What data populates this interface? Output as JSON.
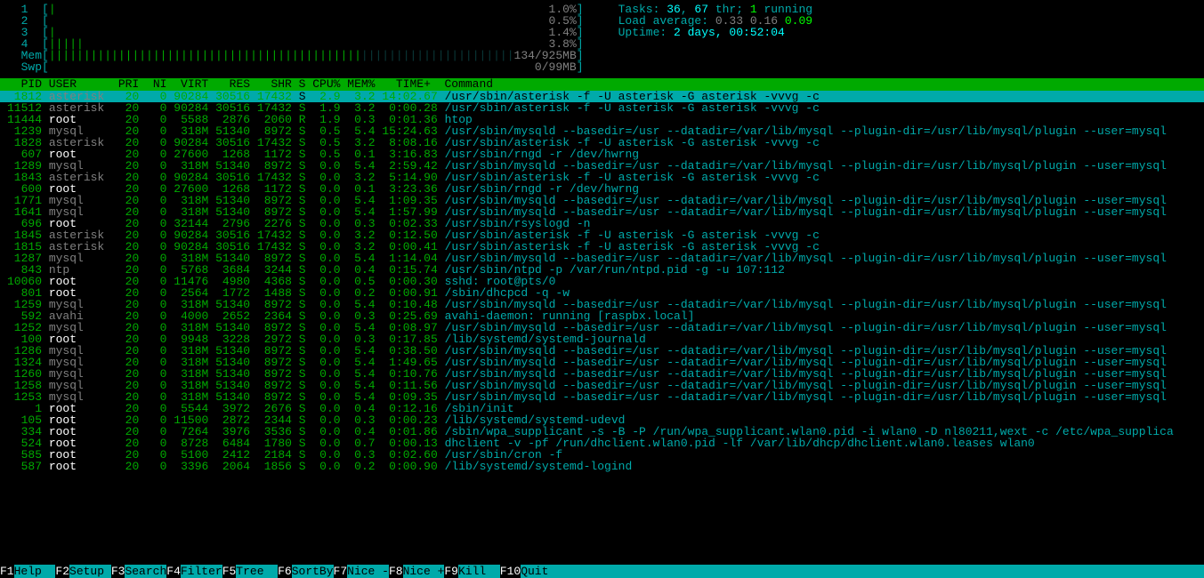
{
  "cpus": [
    {
      "id": "1",
      "bar": "|",
      "pct": "1.0%"
    },
    {
      "id": "2",
      "bar": "",
      "pct": "0.5%"
    },
    {
      "id": "3",
      "bar": "|",
      "pct": "1.4%"
    },
    {
      "id": "4",
      "bar": "|||||",
      "pct": "3.8%"
    }
  ],
  "mem": {
    "label": "Mem",
    "bar": "|||||||||||||||||||||||||||||||||||||||||||||",
    "val": "134/925MB"
  },
  "swp": {
    "label": "Swp",
    "bar": "",
    "val": "0/99MB"
  },
  "tasks": {
    "prefix": "Tasks: ",
    "procs": "36",
    "mid": ", ",
    "threads": "67",
    "thr_label": " thr; ",
    "running": "1",
    "running_label": " running"
  },
  "load": {
    "prefix": "Load average: ",
    "l1": "0.33",
    "l2": "0.16",
    "l3": "0.09"
  },
  "uptime": {
    "prefix": "Uptime: ",
    "val": "2 days, 00:52:04"
  },
  "columns": "  PID USER      PRI  NI  VIRT   RES   SHR S CPU% MEM%   TIME+  Command",
  "processes": [
    {
      "pid": " 1812",
      "user": "asterisk",
      "pri": " 20",
      "ni": "  0",
      "virt": "90284",
      "res": "30516",
      "shr": "17432",
      "s": "S",
      "cpu": " 2.9",
      "mem": " 3.2",
      "time": "14:02.67",
      "cmd": "/usr/sbin/asterisk -f -U asterisk -G asterisk -vvvg -c",
      "selected": true
    },
    {
      "pid": "11512",
      "user": "asterisk",
      "pri": " 20",
      "ni": "  0",
      "virt": "90284",
      "res": "30516",
      "shr": "17432",
      "s": "S",
      "cpu": " 1.9",
      "mem": " 3.2",
      "time": " 0:00.28",
      "cmd": "/usr/sbin/asterisk -f -U asterisk -G asterisk -vvvg -c"
    },
    {
      "pid": "11444",
      "user": "root",
      "pri": " 20",
      "ni": "  0",
      "virt": " 5588",
      "res": " 2876",
      "shr": " 2060",
      "s": "R",
      "cpu": " 1.9",
      "mem": " 0.3",
      "time": " 0:01.36",
      "cmd": "htop"
    },
    {
      "pid": " 1239",
      "user": "mysql",
      "pri": " 20",
      "ni": "  0",
      "virt": " 318M",
      "res": "51340",
      "shr": " 8972",
      "s": "S",
      "cpu": " 0.5",
      "mem": " 5.4",
      "time": "15:24.63",
      "cmd": "/usr/sbin/mysqld --basedir=/usr --datadir=/var/lib/mysql --plugin-dir=/usr/lib/mysql/plugin --user=mysql"
    },
    {
      "pid": " 1828",
      "user": "asterisk",
      "pri": " 20",
      "ni": "  0",
      "virt": "90284",
      "res": "30516",
      "shr": "17432",
      "s": "S",
      "cpu": " 0.5",
      "mem": " 3.2",
      "time": " 8:08.16",
      "cmd": "/usr/sbin/asterisk -f -U asterisk -G asterisk -vvvg -c"
    },
    {
      "pid": "  607",
      "user": "root",
      "pri": " 20",
      "ni": "  0",
      "virt": "27600",
      "res": " 1268",
      "shr": " 1172",
      "s": "S",
      "cpu": " 0.5",
      "mem": " 0.1",
      "time": " 3:16.83",
      "cmd": "/usr/sbin/rngd -r /dev/hwrng"
    },
    {
      "pid": " 1289",
      "user": "mysql",
      "pri": " 20",
      "ni": "  0",
      "virt": " 318M",
      "res": "51340",
      "shr": " 8972",
      "s": "S",
      "cpu": " 0.0",
      "mem": " 5.4",
      "time": " 2:59.42",
      "cmd": "/usr/sbin/mysqld --basedir=/usr --datadir=/var/lib/mysql --plugin-dir=/usr/lib/mysql/plugin --user=mysql"
    },
    {
      "pid": " 1843",
      "user": "asterisk",
      "pri": " 20",
      "ni": "  0",
      "virt": "90284",
      "res": "30516",
      "shr": "17432",
      "s": "S",
      "cpu": " 0.0",
      "mem": " 3.2",
      "time": " 5:14.90",
      "cmd": "/usr/sbin/asterisk -f -U asterisk -G asterisk -vvvg -c"
    },
    {
      "pid": "  600",
      "user": "root",
      "pri": " 20",
      "ni": "  0",
      "virt": "27600",
      "res": " 1268",
      "shr": " 1172",
      "s": "S",
      "cpu": " 0.0",
      "mem": " 0.1",
      "time": " 3:23.36",
      "cmd": "/usr/sbin/rngd -r /dev/hwrng"
    },
    {
      "pid": " 1771",
      "user": "mysql",
      "pri": " 20",
      "ni": "  0",
      "virt": " 318M",
      "res": "51340",
      "shr": " 8972",
      "s": "S",
      "cpu": " 0.0",
      "mem": " 5.4",
      "time": " 1:09.35",
      "cmd": "/usr/sbin/mysqld --basedir=/usr --datadir=/var/lib/mysql --plugin-dir=/usr/lib/mysql/plugin --user=mysql"
    },
    {
      "pid": " 1641",
      "user": "mysql",
      "pri": " 20",
      "ni": "  0",
      "virt": " 318M",
      "res": "51340",
      "shr": " 8972",
      "s": "S",
      "cpu": " 0.0",
      "mem": " 5.4",
      "time": " 1:57.99",
      "cmd": "/usr/sbin/mysqld --basedir=/usr --datadir=/var/lib/mysql --plugin-dir=/usr/lib/mysql/plugin --user=mysql"
    },
    {
      "pid": "  696",
      "user": "root",
      "pri": " 20",
      "ni": "  0",
      "virt": "32144",
      "res": " 2796",
      "shr": " 2276",
      "s": "S",
      "cpu": " 0.0",
      "mem": " 0.3",
      "time": " 0:02.33",
      "cmd": "/usr/sbin/rsyslogd -n"
    },
    {
      "pid": " 1845",
      "user": "asterisk",
      "pri": " 20",
      "ni": "  0",
      "virt": "90284",
      "res": "30516",
      "shr": "17432",
      "s": "S",
      "cpu": " 0.0",
      "mem": " 3.2",
      "time": " 0:12.50",
      "cmd": "/usr/sbin/asterisk -f -U asterisk -G asterisk -vvvg -c"
    },
    {
      "pid": " 1815",
      "user": "asterisk",
      "pri": " 20",
      "ni": "  0",
      "virt": "90284",
      "res": "30516",
      "shr": "17432",
      "s": "S",
      "cpu": " 0.0",
      "mem": " 3.2",
      "time": " 0:00.41",
      "cmd": "/usr/sbin/asterisk -f -U asterisk -G asterisk -vvvg -c"
    },
    {
      "pid": " 1287",
      "user": "mysql",
      "pri": " 20",
      "ni": "  0",
      "virt": " 318M",
      "res": "51340",
      "shr": " 8972",
      "s": "S",
      "cpu": " 0.0",
      "mem": " 5.4",
      "time": " 1:14.04",
      "cmd": "/usr/sbin/mysqld --basedir=/usr --datadir=/var/lib/mysql --plugin-dir=/usr/lib/mysql/plugin --user=mysql"
    },
    {
      "pid": "  843",
      "user": "ntp",
      "pri": " 20",
      "ni": "  0",
      "virt": " 5768",
      "res": " 3684",
      "shr": " 3244",
      "s": "S",
      "cpu": " 0.0",
      "mem": " 0.4",
      "time": " 0:15.74",
      "cmd": "/usr/sbin/ntpd -p /var/run/ntpd.pid -g -u 107:112"
    },
    {
      "pid": "10060",
      "user": "root",
      "pri": " 20",
      "ni": "  0",
      "virt": "11476",
      "res": " 4980",
      "shr": " 4368",
      "s": "S",
      "cpu": " 0.0",
      "mem": " 0.5",
      "time": " 0:00.30",
      "cmd": "sshd: root@pts/0"
    },
    {
      "pid": "  801",
      "user": "root",
      "pri": " 20",
      "ni": "  0",
      "virt": " 2564",
      "res": " 1772",
      "shr": " 1488",
      "s": "S",
      "cpu": " 0.0",
      "mem": " 0.2",
      "time": " 0:00.91",
      "cmd": "/sbin/dhcpcd -q -w"
    },
    {
      "pid": " 1259",
      "user": "mysql",
      "pri": " 20",
      "ni": "  0",
      "virt": " 318M",
      "res": "51340",
      "shr": " 8972",
      "s": "S",
      "cpu": " 0.0",
      "mem": " 5.4",
      "time": " 0:10.48",
      "cmd": "/usr/sbin/mysqld --basedir=/usr --datadir=/var/lib/mysql --plugin-dir=/usr/lib/mysql/plugin --user=mysql"
    },
    {
      "pid": "  592",
      "user": "avahi",
      "pri": " 20",
      "ni": "  0",
      "virt": " 4000",
      "res": " 2652",
      "shr": " 2364",
      "s": "S",
      "cpu": " 0.0",
      "mem": " 0.3",
      "time": " 0:25.69",
      "cmd": "avahi-daemon: running [raspbx.local]"
    },
    {
      "pid": " 1252",
      "user": "mysql",
      "pri": " 20",
      "ni": "  0",
      "virt": " 318M",
      "res": "51340",
      "shr": " 8972",
      "s": "S",
      "cpu": " 0.0",
      "mem": " 5.4",
      "time": " 0:08.97",
      "cmd": "/usr/sbin/mysqld --basedir=/usr --datadir=/var/lib/mysql --plugin-dir=/usr/lib/mysql/plugin --user=mysql"
    },
    {
      "pid": "  100",
      "user": "root",
      "pri": " 20",
      "ni": "  0",
      "virt": " 9948",
      "res": " 3228",
      "shr": " 2972",
      "s": "S",
      "cpu": " 0.0",
      "mem": " 0.3",
      "time": " 0:17.85",
      "cmd": "/lib/systemd/systemd-journald"
    },
    {
      "pid": " 1286",
      "user": "mysql",
      "pri": " 20",
      "ni": "  0",
      "virt": " 318M",
      "res": "51340",
      "shr": " 8972",
      "s": "S",
      "cpu": " 0.0",
      "mem": " 5.4",
      "time": " 0:38.50",
      "cmd": "/usr/sbin/mysqld --basedir=/usr --datadir=/var/lib/mysql --plugin-dir=/usr/lib/mysql/plugin --user=mysql"
    },
    {
      "pid": " 1324",
      "user": "mysql",
      "pri": " 20",
      "ni": "  0",
      "virt": " 318M",
      "res": "51340",
      "shr": " 8972",
      "s": "S",
      "cpu": " 0.0",
      "mem": " 5.4",
      "time": " 1:49.65",
      "cmd": "/usr/sbin/mysqld --basedir=/usr --datadir=/var/lib/mysql --plugin-dir=/usr/lib/mysql/plugin --user=mysql"
    },
    {
      "pid": " 1260",
      "user": "mysql",
      "pri": " 20",
      "ni": "  0",
      "virt": " 318M",
      "res": "51340",
      "shr": " 8972",
      "s": "S",
      "cpu": " 0.0",
      "mem": " 5.4",
      "time": " 0:10.76",
      "cmd": "/usr/sbin/mysqld --basedir=/usr --datadir=/var/lib/mysql --plugin-dir=/usr/lib/mysql/plugin --user=mysql"
    },
    {
      "pid": " 1258",
      "user": "mysql",
      "pri": " 20",
      "ni": "  0",
      "virt": " 318M",
      "res": "51340",
      "shr": " 8972",
      "s": "S",
      "cpu": " 0.0",
      "mem": " 5.4",
      "time": " 0:11.56",
      "cmd": "/usr/sbin/mysqld --basedir=/usr --datadir=/var/lib/mysql --plugin-dir=/usr/lib/mysql/plugin --user=mysql"
    },
    {
      "pid": " 1253",
      "user": "mysql",
      "pri": " 20",
      "ni": "  0",
      "virt": " 318M",
      "res": "51340",
      "shr": " 8972",
      "s": "S",
      "cpu": " 0.0",
      "mem": " 5.4",
      "time": " 0:09.35",
      "cmd": "/usr/sbin/mysqld --basedir=/usr --datadir=/var/lib/mysql --plugin-dir=/usr/lib/mysql/plugin --user=mysql"
    },
    {
      "pid": "    1",
      "user": "root",
      "pri": " 20",
      "ni": "  0",
      "virt": " 5544",
      "res": " 3972",
      "shr": " 2676",
      "s": "S",
      "cpu": " 0.0",
      "mem": " 0.4",
      "time": " 0:12.16",
      "cmd": "/sbin/init"
    },
    {
      "pid": "  105",
      "user": "root",
      "pri": " 20",
      "ni": "  0",
      "virt": "11500",
      "res": " 2872",
      "shr": " 2344",
      "s": "S",
      "cpu": " 0.0",
      "mem": " 0.3",
      "time": " 0:00.23",
      "cmd": "/lib/systemd/systemd-udevd"
    },
    {
      "pid": "  334",
      "user": "root",
      "pri": " 20",
      "ni": "  0",
      "virt": " 7264",
      "res": " 3976",
      "shr": " 3536",
      "s": "S",
      "cpu": " 0.0",
      "mem": " 0.4",
      "time": " 0:01.86",
      "cmd": "/sbin/wpa_supplicant -s -B -P /run/wpa_supplicant.wlan0.pid -i wlan0 -D nl80211,wext -c /etc/wpa_supplica"
    },
    {
      "pid": "  524",
      "user": "root",
      "pri": " 20",
      "ni": "  0",
      "virt": " 8728",
      "res": " 6484",
      "shr": " 1780",
      "s": "S",
      "cpu": " 0.0",
      "mem": " 0.7",
      "time": " 0:00.13",
      "cmd": "dhclient -v -pf /run/dhclient.wlan0.pid -lf /var/lib/dhcp/dhclient.wlan0.leases wlan0"
    },
    {
      "pid": "  585",
      "user": "root",
      "pri": " 20",
      "ni": "  0",
      "virt": " 5100",
      "res": " 2412",
      "shr": " 2184",
      "s": "S",
      "cpu": " 0.0",
      "mem": " 0.3",
      "time": " 0:02.60",
      "cmd": "/usr/sbin/cron -f"
    },
    {
      "pid": "  587",
      "user": "root",
      "pri": " 20",
      "ni": "  0",
      "virt": " 3396",
      "res": " 2064",
      "shr": " 1856",
      "s": "S",
      "cpu": " 0.0",
      "mem": " 0.2",
      "time": " 0:00.90",
      "cmd": "/lib/systemd/systemd-logind"
    }
  ],
  "footer": [
    {
      "key": "F1",
      "label": "Help  "
    },
    {
      "key": "F2",
      "label": "Setup "
    },
    {
      "key": "F3",
      "label": "Search"
    },
    {
      "key": "F4",
      "label": "Filter"
    },
    {
      "key": "F5",
      "label": "Tree  "
    },
    {
      "key": "F6",
      "label": "SortBy"
    },
    {
      "key": "F7",
      "label": "Nice -"
    },
    {
      "key": "F8",
      "label": "Nice +"
    },
    {
      "key": "F9",
      "label": "Kill  "
    },
    {
      "key": "F10",
      "label": "Quit  "
    }
  ]
}
